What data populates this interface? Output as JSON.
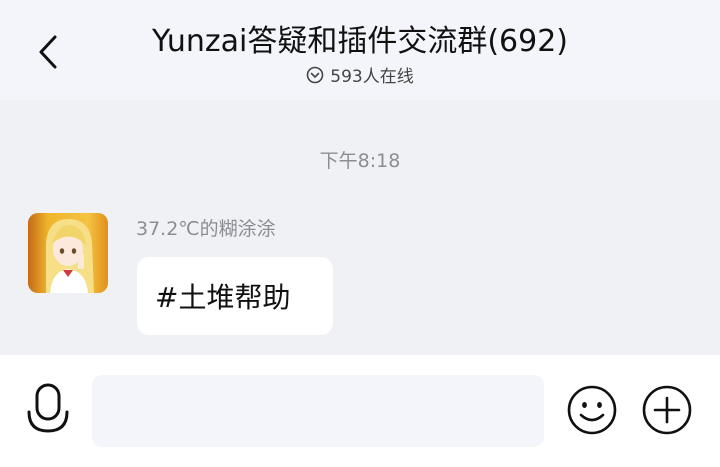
{
  "header": {
    "title": "Yunzai答疑和插件交流群(692)",
    "online_text": "593人在线",
    "back_icon": "chevron-left-icon",
    "online_icon": "chevron-down-circle-icon"
  },
  "chat": {
    "timestamp": "下午8:18",
    "messages": [
      {
        "sender": "37.2℃的糊涂涂",
        "text": "#土堆帮助"
      }
    ]
  },
  "input_bar": {
    "input_value": "",
    "icons": [
      "microphone-icon",
      "emoji-icon",
      "plus-icon"
    ]
  },
  "colors": {
    "header_bg": "#f4f5fa",
    "chat_bg": "#f0f1f5",
    "meta_text": "#8c8c95",
    "bubble_bg": "#ffffff"
  }
}
